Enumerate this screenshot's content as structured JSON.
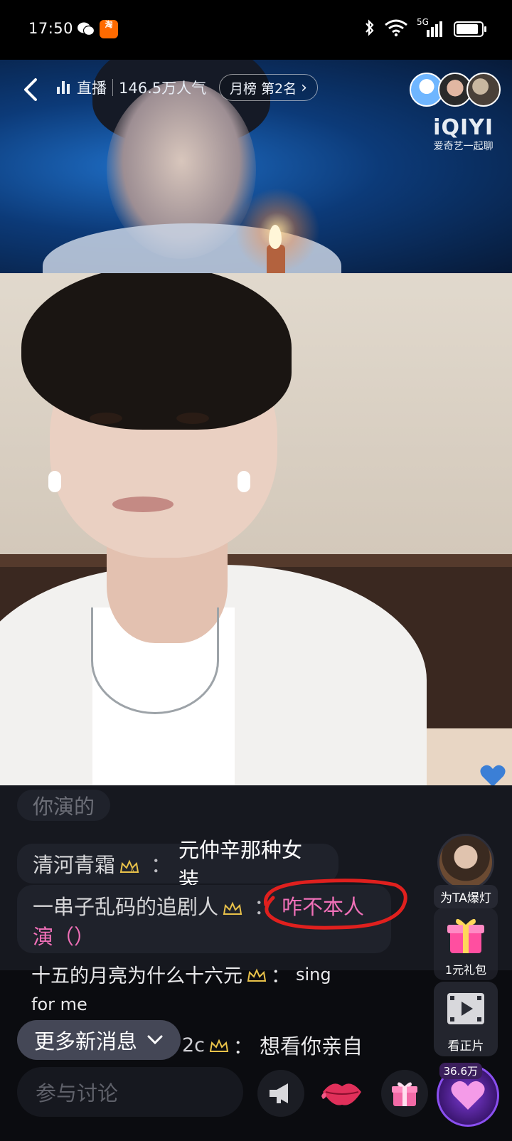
{
  "status_bar": {
    "time": "17:50",
    "taobao_label": "淘",
    "network": "5G",
    "battery_level": 0.9
  },
  "live_header": {
    "live_label": "直播",
    "popularity": "146.5万人气",
    "rank": "月榜 第2名",
    "rank_chevron": "›",
    "logo_brand": "iQIYI",
    "logo_sub": "爱奇艺一起聊"
  },
  "chat": {
    "faded_message": "你演的",
    "messages": [
      {
        "user": "清河青霜",
        "sep": "：",
        "text": "元仲辛那种女装"
      },
      {
        "user": "一串子乱码的追剧人",
        "sep": "：",
        "text": "咋不本人",
        "text2": "演（）"
      }
    ],
    "message3_line1": "十五的月亮为什么十六元",
    "message3_sep": "：",
    "message3_text": "sing",
    "message3_line2": "for me",
    "message4_user_suffix": "2c",
    "message4_sep": "：",
    "message4_text": "想看你亲自"
  },
  "more_messages_label": "更多新消息",
  "discuss_placeholder": "参与讨论",
  "side": {
    "boost_label": "为TA爆灯",
    "gift_pack_label": "1元礼包",
    "watch_full_label": "看正片",
    "like_count": "36.6万"
  },
  "colors": {
    "accent_purple": "#7d3bd6",
    "highlight_pink": "#f070b8",
    "annotation_red": "#e0201e"
  }
}
